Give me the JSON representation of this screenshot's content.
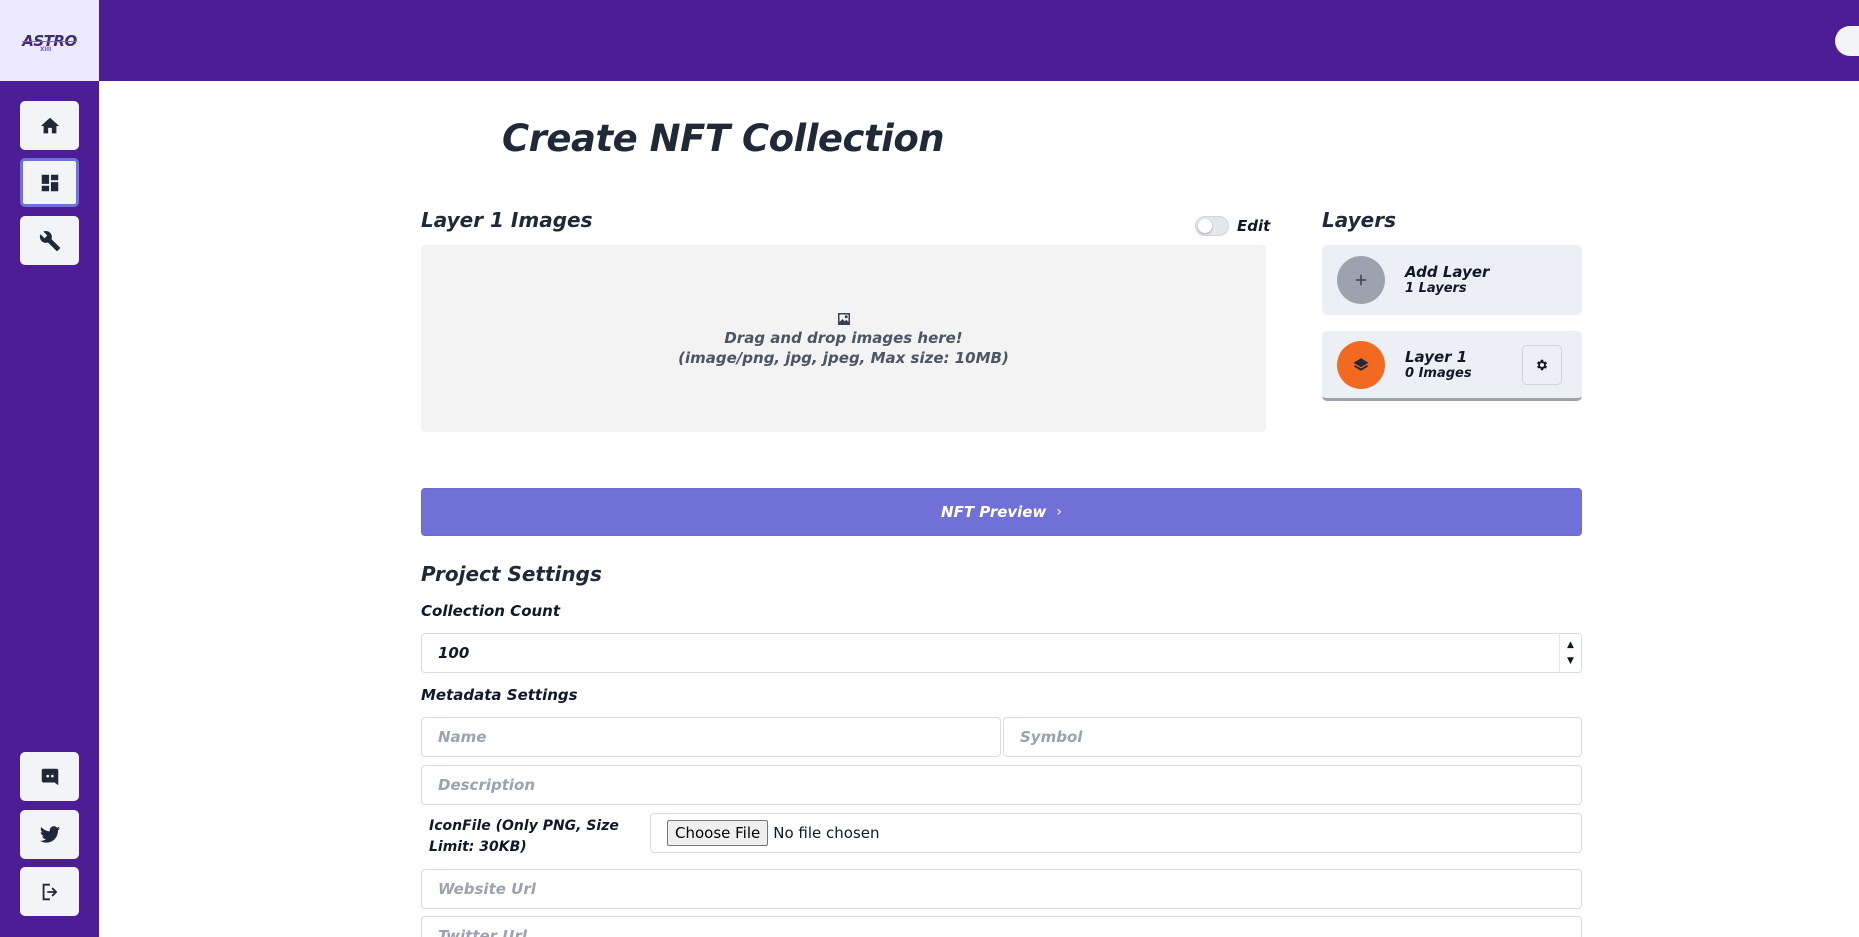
{
  "brand": {
    "logo_text": "ASTRO",
    "logo_sub": "XIII"
  },
  "sidebar": {
    "items": [
      {
        "icon": "home-icon"
      },
      {
        "icon": "dashboard-icon"
      },
      {
        "icon": "wrench-icon"
      },
      {
        "icon": "discord-icon"
      },
      {
        "icon": "twitter-icon"
      },
      {
        "icon": "logout-icon"
      }
    ]
  },
  "page": {
    "title": "Create NFT Collection"
  },
  "images_section": {
    "heading": "Layer 1 Images",
    "edit_label": "Edit",
    "edit_enabled": false,
    "drop_line1": "Drag and drop images here!",
    "drop_line2": "(image/png, jpg, jpeg, Max size: 10MB)"
  },
  "layers_section": {
    "heading": "Layers",
    "add": {
      "name": "Add Layer",
      "sub": "1 Layers"
    },
    "items": [
      {
        "name": "Layer 1",
        "sub": "0 Images"
      }
    ]
  },
  "preview_button": {
    "label": "NFT Preview",
    "chevron": "›"
  },
  "project_settings": {
    "heading": "Project Settings",
    "collection_count_label": "Collection Count",
    "collection_count_value": "100",
    "stepper_up": "▲",
    "stepper_down": "▼",
    "metadata_label": "Metadata Settings",
    "name_placeholder": "Name",
    "symbol_placeholder": "Symbol",
    "description_placeholder": "Description",
    "icon_file_label": "IconFile (Only PNG, Size Limit: 30KB)",
    "choose_file_label": "Choose File",
    "file_status": "No file chosen",
    "website_placeholder": "Website Url",
    "twitter_placeholder": "Twitter Url"
  },
  "colors": {
    "topbar": "#4c1d95",
    "accent": "#7070d6",
    "layer_active": "#f26a22"
  }
}
